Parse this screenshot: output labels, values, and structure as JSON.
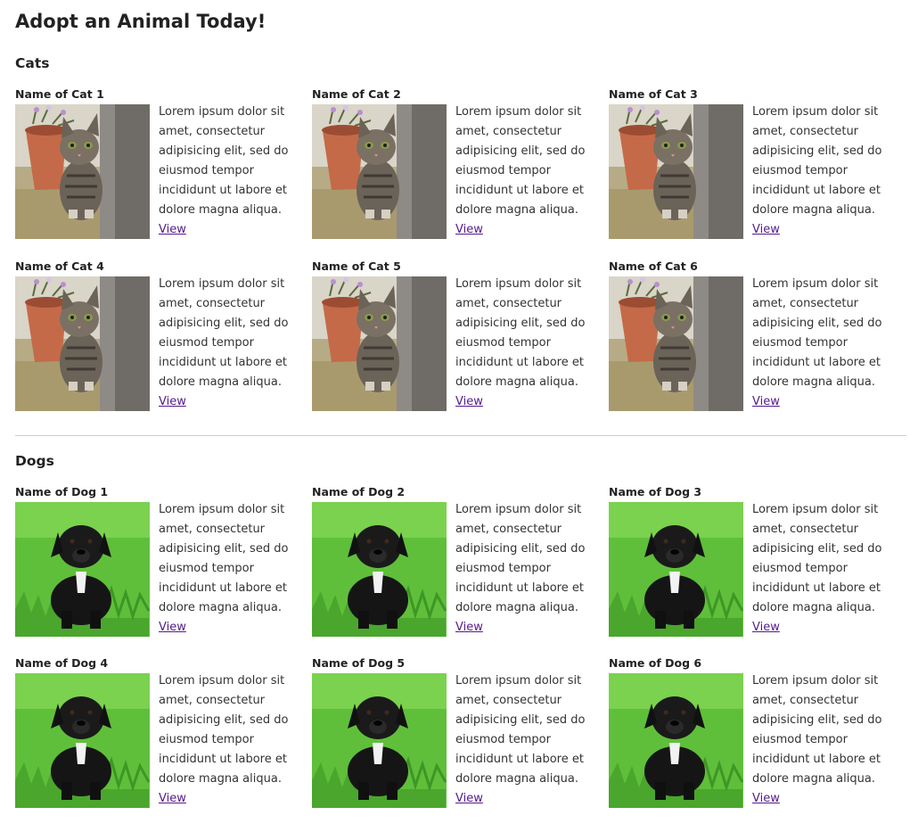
{
  "page": {
    "title": "Adopt an Animal Today!"
  },
  "sections": {
    "cats": {
      "title": "Cats",
      "items": [
        {
          "name": "Name of Cat 1",
          "description": "Lorem ipsum dolor sit amet, consectetur adipisicing elit, sed do eiusmod tempor incididunt ut labore et dolore magna aliqua.",
          "link": "View"
        },
        {
          "name": "Name of Cat 2",
          "description": "Lorem ipsum dolor sit amet, consectetur adipisicing elit, sed do eiusmod tempor incididunt ut labore et dolore magna aliqua.",
          "link": "View"
        },
        {
          "name": "Name of Cat 3",
          "description": "Lorem ipsum dolor sit amet, consectetur adipisicing elit, sed do eiusmod tempor incididunt ut labore et dolore magna aliqua.",
          "link": "View"
        },
        {
          "name": "Name of Cat 4",
          "description": "Lorem ipsum dolor sit amet, consectetur adipisicing elit, sed do eiusmod tempor incididunt ut labore et dolore magna aliqua.",
          "link": "View"
        },
        {
          "name": "Name of Cat 5",
          "description": "Lorem ipsum dolor sit amet, consectetur adipisicing elit, sed do eiusmod tempor incididunt ut labore et dolore magna aliqua.",
          "link": "View"
        },
        {
          "name": "Name of Cat 6",
          "description": "Lorem ipsum dolor sit amet, consectetur adipisicing elit, sed do eiusmod tempor incididunt ut labore et dolore magna aliqua.",
          "link": "View"
        }
      ]
    },
    "dogs": {
      "title": "Dogs",
      "items": [
        {
          "name": "Name of Dog 1",
          "description": "Lorem ipsum dolor sit amet, consectetur adipisicing elit, sed do eiusmod tempor incididunt ut labore et dolore magna aliqua.",
          "link": "View"
        },
        {
          "name": "Name of Dog 2",
          "description": "Lorem ipsum dolor sit amet, consectetur adipisicing elit, sed do eiusmod tempor incididunt ut labore et dolore magna aliqua.",
          "link": "View"
        },
        {
          "name": "Name of Dog 3",
          "description": "Lorem ipsum dolor sit amet, consectetur adipisicing elit, sed do eiusmod tempor incididunt ut labore et dolore magna aliqua.",
          "link": "View"
        },
        {
          "name": "Name of Dog 4",
          "description": "Lorem ipsum dolor sit amet, consectetur adipisicing elit, sed do eiusmod tempor incididunt ut labore et dolore magna aliqua.",
          "link": "View"
        },
        {
          "name": "Name of Dog 5",
          "description": "Lorem ipsum dolor sit amet, consectetur adipisicing elit, sed do eiusmod tempor incididunt ut labore et dolore magna aliqua.",
          "link": "View"
        },
        {
          "name": "Name of Dog 6",
          "description": "Lorem ipsum dolor sit amet, consectetur adipisicing elit, sed do eiusmod tempor incididunt ut labore et dolore magna aliqua.",
          "link": "View"
        }
      ]
    }
  },
  "colors": {
    "link": "#551a8b",
    "divider": "#cccccc",
    "text": "#222222"
  }
}
